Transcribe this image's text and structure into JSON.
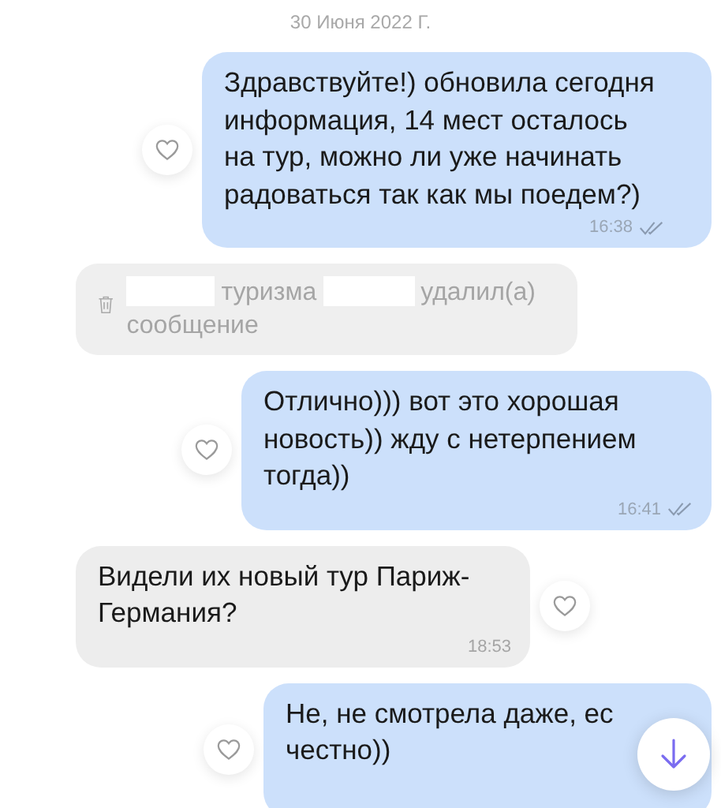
{
  "date_label": "30 Июня 2022 Г.",
  "messages": [
    {
      "kind": "outgoing",
      "text": "Здравствуйте!) обновила сегодня информация, 14 мест осталось на тур, можно ли уже начинать радоваться так как мы поедем?)",
      "time": "16:38",
      "read": true
    },
    {
      "kind": "deleted",
      "parts": [
        {
          "kind": "redacted"
        },
        {
          "kind": "text",
          "text": "туризма"
        },
        {
          "kind": "redacted"
        },
        {
          "kind": "text",
          "text": "удалил(а)"
        },
        {
          "kind": "text",
          "text": "сообщение"
        }
      ]
    },
    {
      "kind": "outgoing",
      "text": "Отлично))) вот это хорошая новость)) жду с нетерпением тогда))",
      "time": "16:41",
      "read": true
    },
    {
      "kind": "incoming",
      "text": "Видели их новый тур Париж-Германия?",
      "time": "18:53"
    },
    {
      "kind": "outgoing",
      "text": "Не, не смотрела даже, ес\nчестно))"
    }
  ]
}
